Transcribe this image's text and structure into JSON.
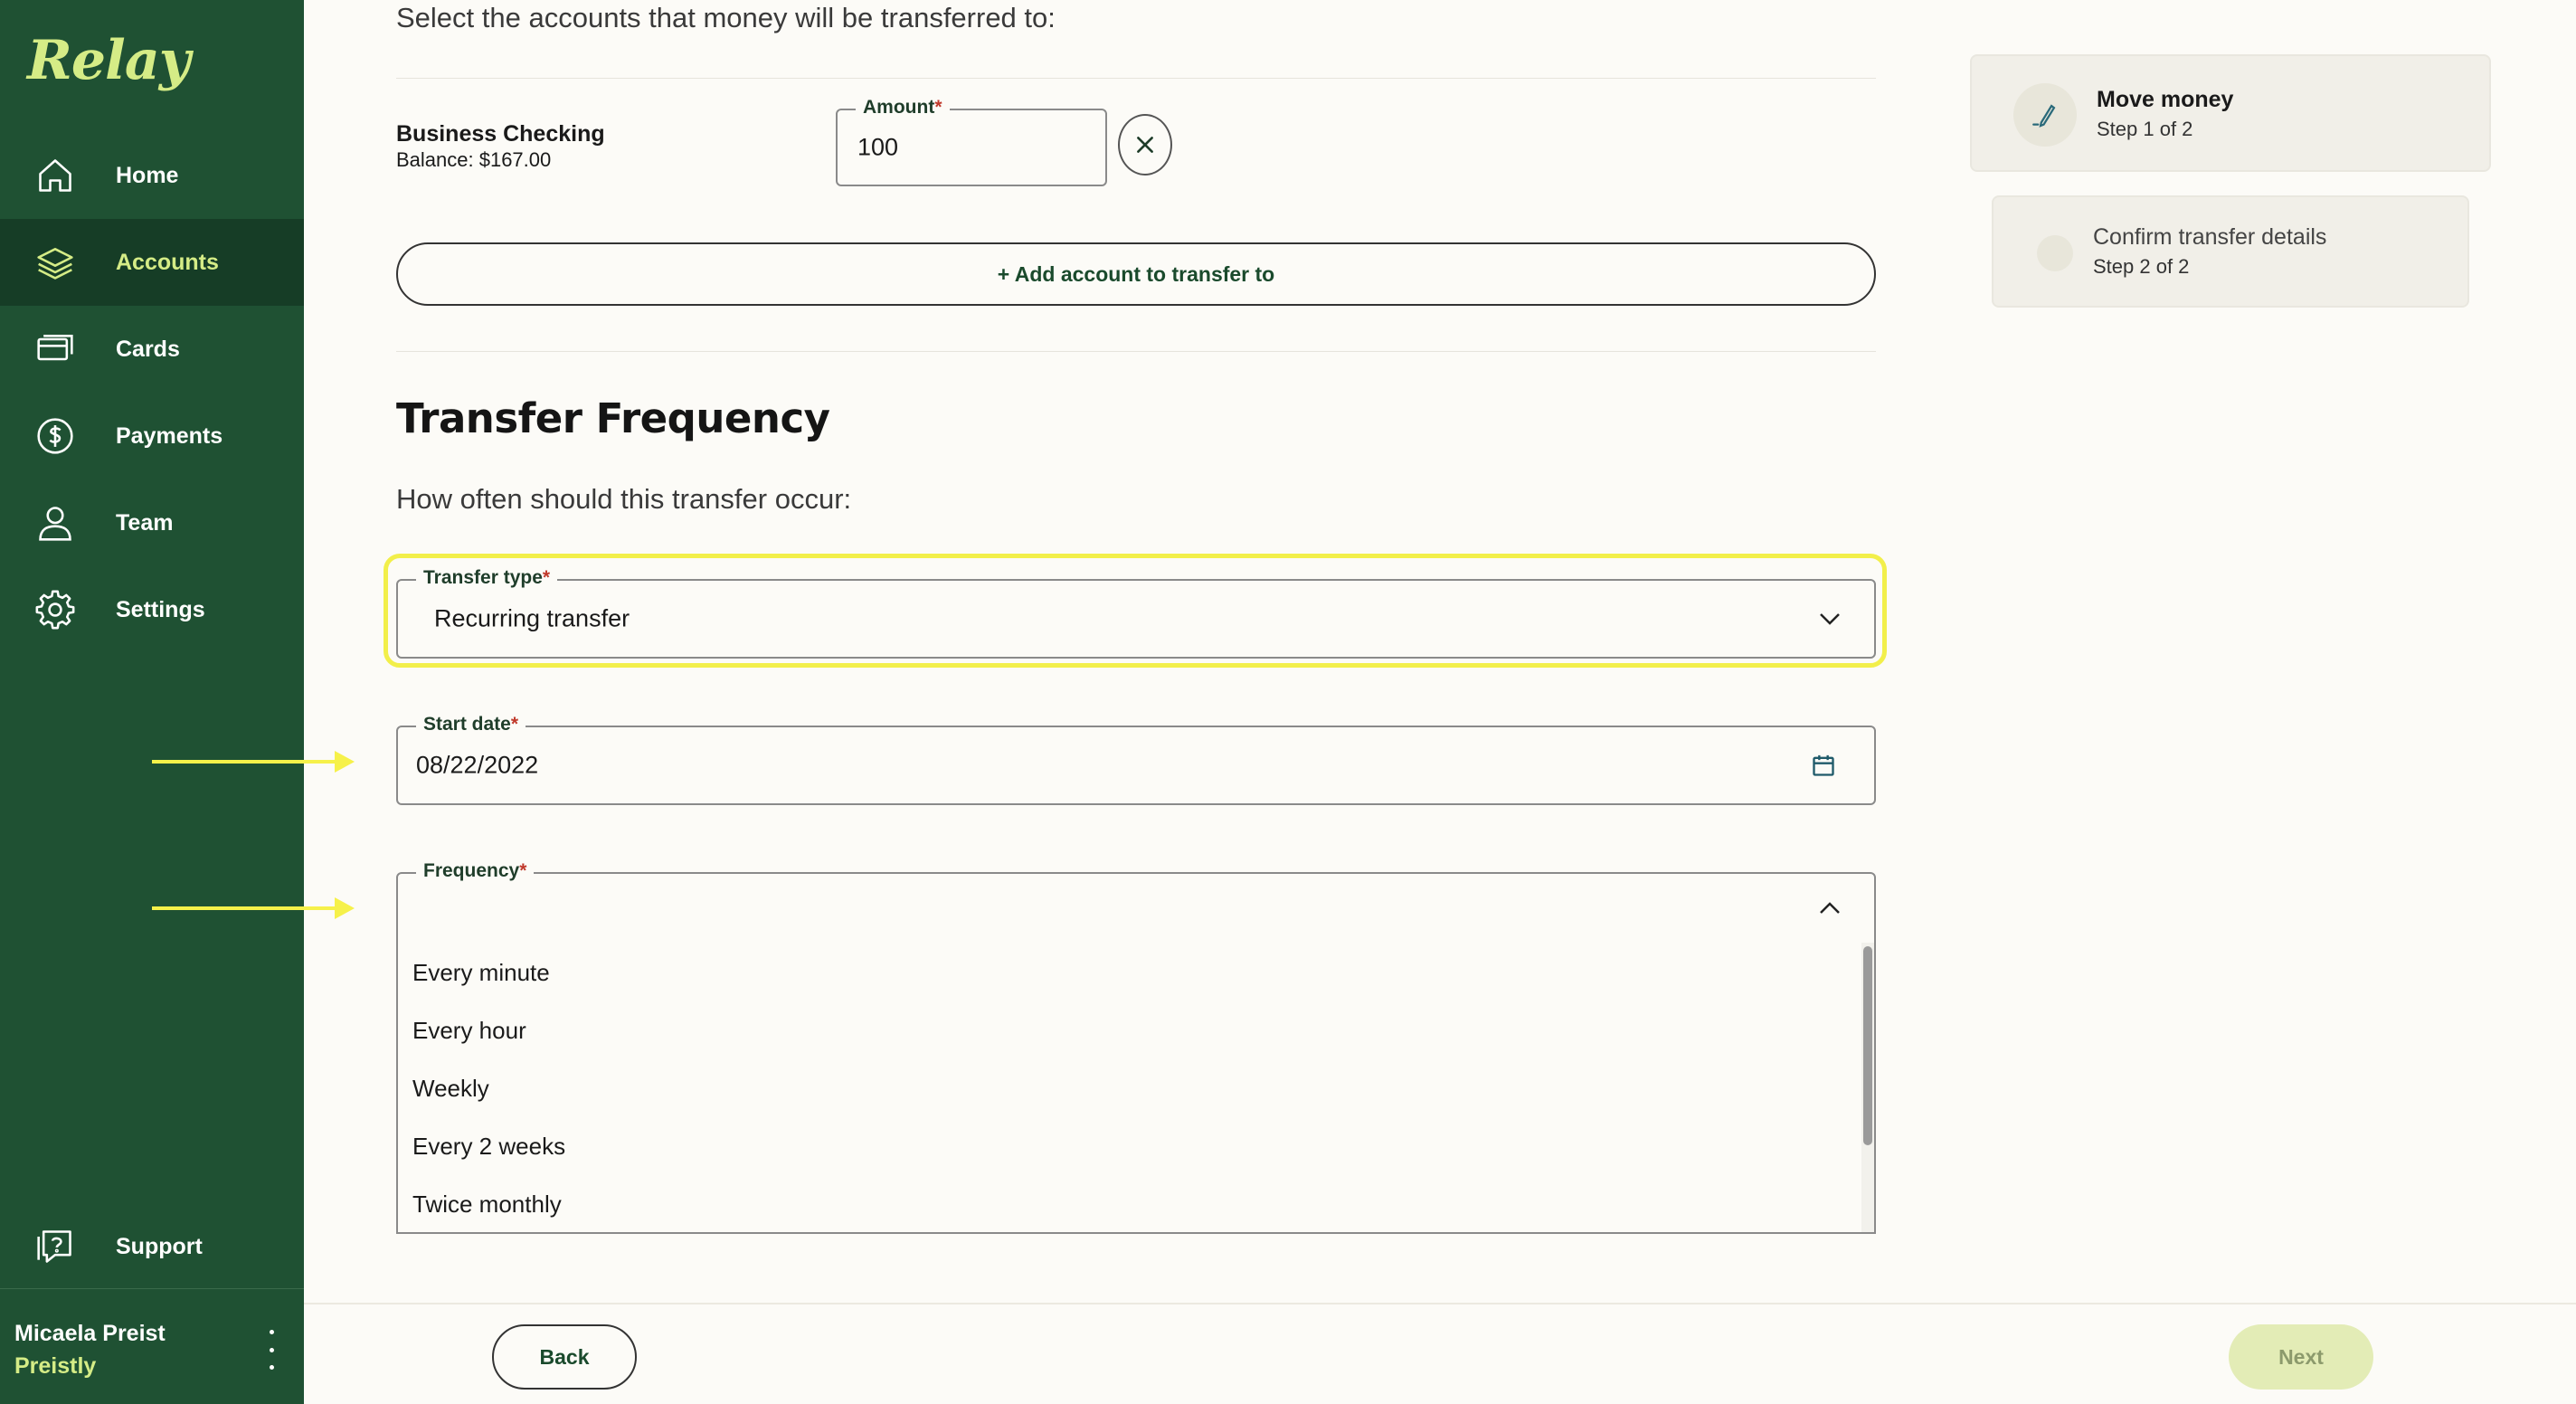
{
  "app": {
    "logo": "Relay"
  },
  "sidebar": {
    "items": [
      {
        "label": "Home",
        "icon": "home-icon"
      },
      {
        "label": "Accounts",
        "icon": "layers-icon",
        "active": true
      },
      {
        "label": "Cards",
        "icon": "card-icon"
      },
      {
        "label": "Payments",
        "icon": "dollar-icon"
      },
      {
        "label": "Team",
        "icon": "person-icon"
      },
      {
        "label": "Settings",
        "icon": "gear-icon"
      }
    ],
    "support": {
      "label": "Support",
      "icon": "support-icon"
    },
    "user": {
      "name": "Micaela Preist",
      "org": "Preistly"
    }
  },
  "transfer": {
    "instruction": "Select the accounts that money will be transferred to:",
    "account": {
      "name": "Business Checking",
      "balance": "Balance: $167.00"
    },
    "amount": {
      "label": "Amount",
      "required_mark": "*",
      "value": "100"
    },
    "add_account_label": "+ Add account to transfer to"
  },
  "frequency_section": {
    "title": "Transfer Frequency",
    "subtitle": "How often should this transfer occur:",
    "transfer_type": {
      "label": "Transfer type",
      "required_mark": "*",
      "value": "Recurring transfer"
    },
    "start_date": {
      "label": "Start date",
      "required_mark": "*",
      "value": "08/22/2022"
    },
    "frequency": {
      "label": "Frequency",
      "required_mark": "*",
      "value": "",
      "options": [
        "Every minute",
        "Every hour",
        "Weekly",
        "Every 2 weeks",
        "Twice monthly"
      ]
    }
  },
  "stepper": {
    "steps": [
      {
        "title": "Move money",
        "subtitle": "Step 1 of 2",
        "active": true
      },
      {
        "title": "Confirm transfer details",
        "subtitle": "Step 2 of 2",
        "active": false
      }
    ]
  },
  "footer": {
    "back_label": "Back",
    "next_label": "Next"
  },
  "colors": {
    "sidebar_bg": "#1f5133",
    "accent": "#d5ec86",
    "highlight": "#f2ef4a",
    "page_bg": "#fcfbf7"
  }
}
